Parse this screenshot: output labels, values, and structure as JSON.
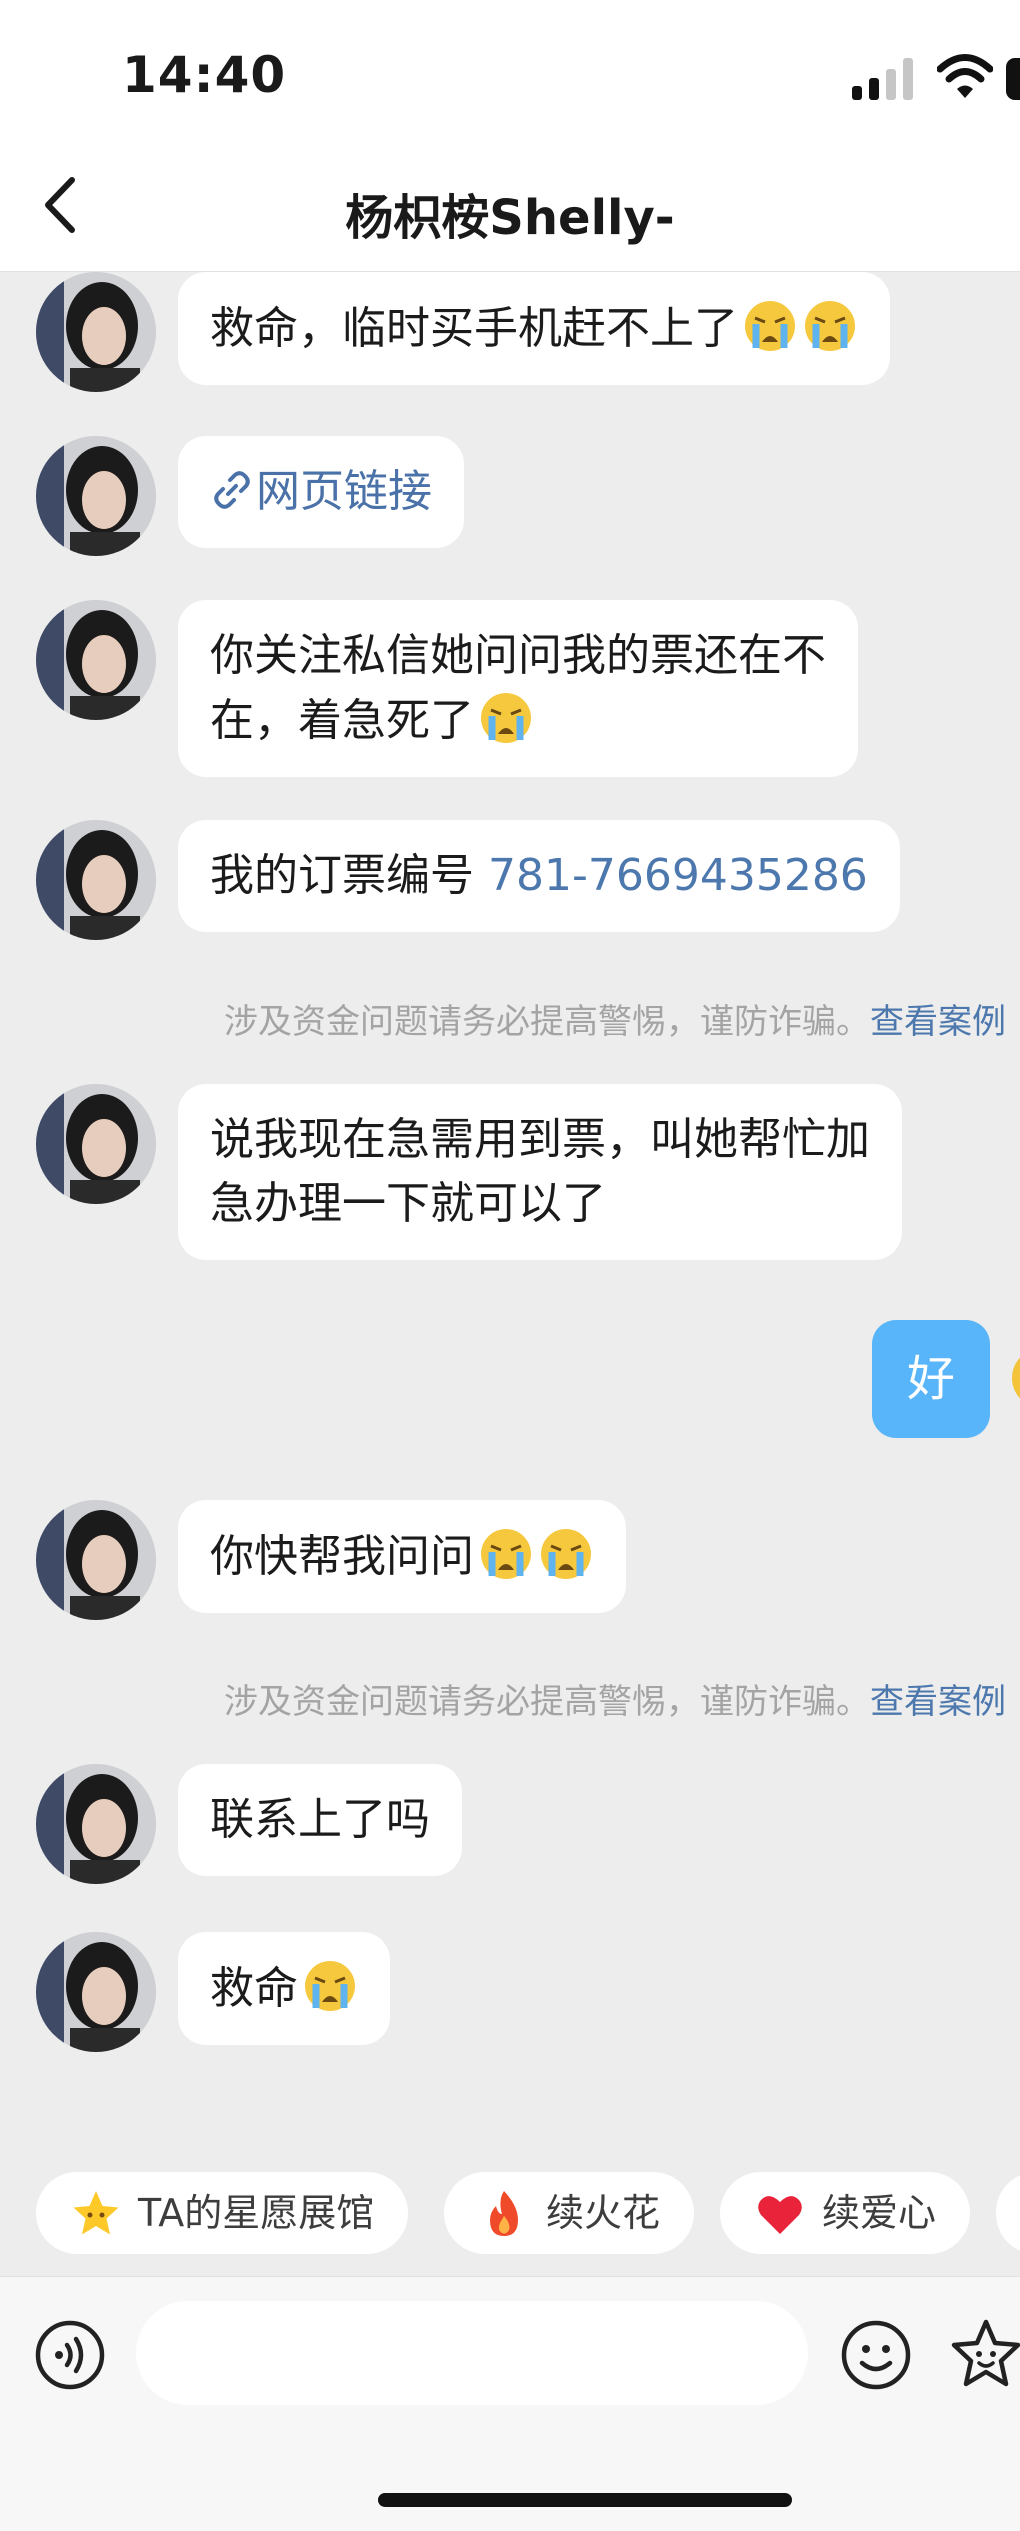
{
  "status_bar": {
    "time": "14:40"
  },
  "header": {
    "title": "杨枳桉Shelly-",
    "back_icon": "chevron-left-icon"
  },
  "messages": [
    {
      "text": "救命，临时买手机赶不上了",
      "emojis": 2
    },
    {
      "link_text": "网页链接",
      "icon": "link-icon"
    },
    {
      "line1": "你关注私信她问问我的票还在不",
      "line2": "在，着急死了",
      "emojis": 1
    },
    {
      "prefix": "我的订票编号 ",
      "order_number": "781-7669435286"
    },
    {
      "line1": "说我现在急需用到票，叫她帮忙加",
      "line2": "急办理一下就可以了"
    },
    {
      "text": "你快帮我问问",
      "emojis": 2
    },
    {
      "text": "联系上了吗"
    },
    {
      "text": "救命",
      "emojis": 1
    }
  ],
  "my_message": {
    "text": "好"
  },
  "warning": {
    "text": "涉及资金问题请务必提高警惕，谨防诈骗。",
    "link": "查看案例"
  },
  "quick_actions": [
    {
      "label": "TA的星愿展馆",
      "icon": "star-icon"
    },
    {
      "label": "续火花",
      "icon": "fire-icon"
    },
    {
      "label": "续爱心",
      "icon": "heart-icon"
    }
  ],
  "input": {
    "placeholder": ""
  },
  "colors": {
    "self_bubble": "#58b5f9",
    "link": "#4c78ad",
    "background": "#ededed"
  }
}
